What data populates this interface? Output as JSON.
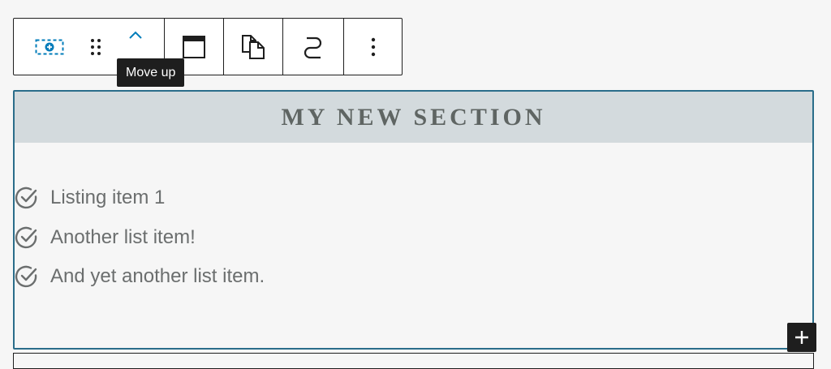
{
  "toolbar": {
    "buttons": [
      {
        "icon": "add-section-icon",
        "label": "Add section"
      },
      {
        "icon": "drag-handle-icon",
        "label": "Drag"
      },
      {
        "icon": "chevron-up-icon",
        "label": "Move up"
      },
      {
        "icon": "layout-icon",
        "label": "Change layout"
      },
      {
        "icon": "duplicate-icon",
        "label": "Duplicate"
      },
      {
        "icon": "transform-icon",
        "label": "Transform"
      },
      {
        "icon": "more-options-icon",
        "label": "Options"
      }
    ],
    "tooltip": "Move up",
    "accent_color": "#007cba"
  },
  "section": {
    "title": "MY NEW SECTION",
    "items": [
      {
        "icon": "check-circle-icon",
        "text": "Listing item 1"
      },
      {
        "icon": "check-circle-icon",
        "text": "Another list item!"
      },
      {
        "icon": "check-circle-icon",
        "text": "And yet another list item."
      }
    ],
    "border_color": "#2a6d8a",
    "header_bg": "#d3dadd"
  },
  "inserter": {
    "icon": "plus-icon",
    "label": "Add block"
  }
}
